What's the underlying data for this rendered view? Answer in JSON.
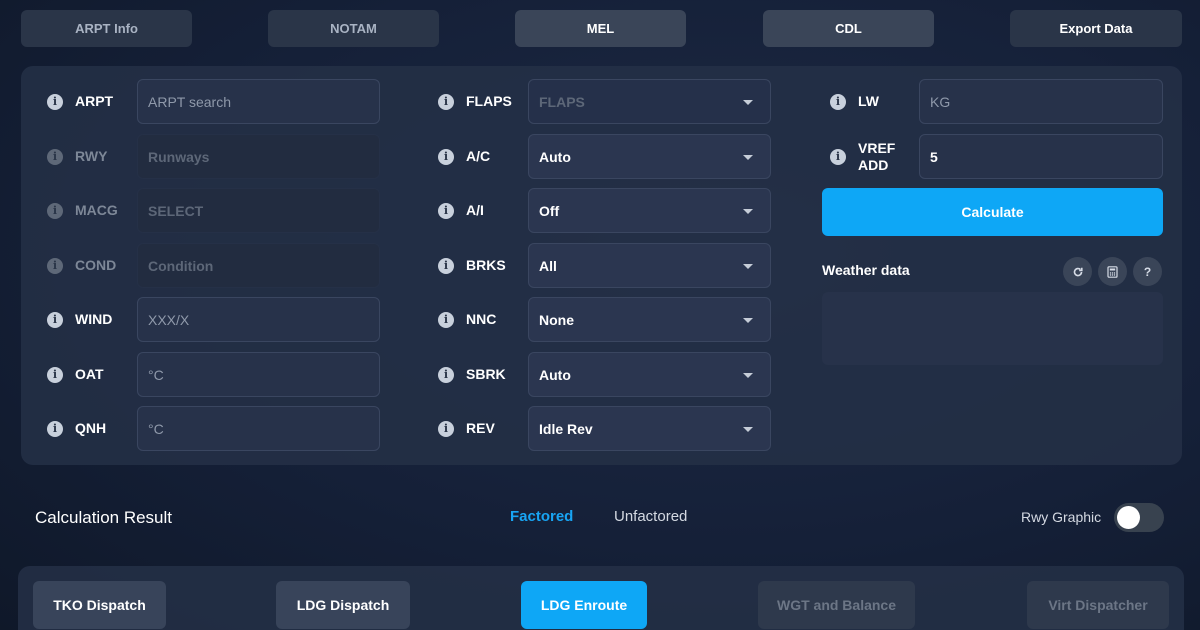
{
  "top_tabs": [
    "ARPT Info",
    "NOTAM",
    "MEL",
    "CDL",
    "Export Data"
  ],
  "left_fields": [
    {
      "label": "ARPT",
      "placeholder": "ARPT search",
      "enabled": true
    },
    {
      "label": "RWY",
      "placeholder": "Runways",
      "enabled": false
    },
    {
      "label": "MACG",
      "placeholder": "SELECT",
      "enabled": false
    },
    {
      "label": "COND",
      "placeholder": "Condition",
      "enabled": false
    },
    {
      "label": "WIND",
      "placeholder": "XXX/X",
      "enabled": true
    },
    {
      "label": "OAT",
      "placeholder": "°C",
      "enabled": true
    },
    {
      "label": "QNH",
      "placeholder": "°C",
      "enabled": true
    }
  ],
  "mid_fields": [
    {
      "label": "FLAPS",
      "value": "FLAPS",
      "enabled": false
    },
    {
      "label": "A/C",
      "value": "Auto",
      "enabled": true
    },
    {
      "label": "A/I",
      "value": "Off",
      "enabled": true
    },
    {
      "label": "BRKS",
      "value": "All",
      "enabled": true
    },
    {
      "label": "NNC",
      "value": "None",
      "enabled": true
    },
    {
      "label": "SBRK",
      "value": "Auto",
      "enabled": true
    },
    {
      "label": "REV",
      "value": "Idle Rev",
      "enabled": true
    }
  ],
  "right_fields": {
    "lw": {
      "label": "LW",
      "placeholder": "KG"
    },
    "vref": {
      "label_line1": "VREF",
      "label_line2": "ADD",
      "value": "5"
    }
  },
  "calculate_label": "Calculate",
  "weather": {
    "label": "Weather data",
    "icons": [
      "refresh-icon",
      "calculator-icon",
      "help-icon"
    ],
    "help_glyph": "?"
  },
  "result": {
    "title": "Calculation Result",
    "tabs": [
      "Factored",
      "Unfactored"
    ],
    "active_tab": "Factored",
    "rwy_graphic_label": "Rwy Graphic",
    "rwy_graphic_on": false
  },
  "bottom_buttons": [
    {
      "label": "TKO Dispatch",
      "state": "normal"
    },
    {
      "label": "LDG Dispatch",
      "state": "normal"
    },
    {
      "label": "LDG Enroute",
      "state": "active"
    },
    {
      "label": "WGT and Balance",
      "state": "disabled"
    },
    {
      "label": "Virt Dispatcher",
      "state": "disabled"
    }
  ],
  "colors": {
    "accent": "#0ea7f6",
    "background": "#152038",
    "panel": "#243046"
  }
}
